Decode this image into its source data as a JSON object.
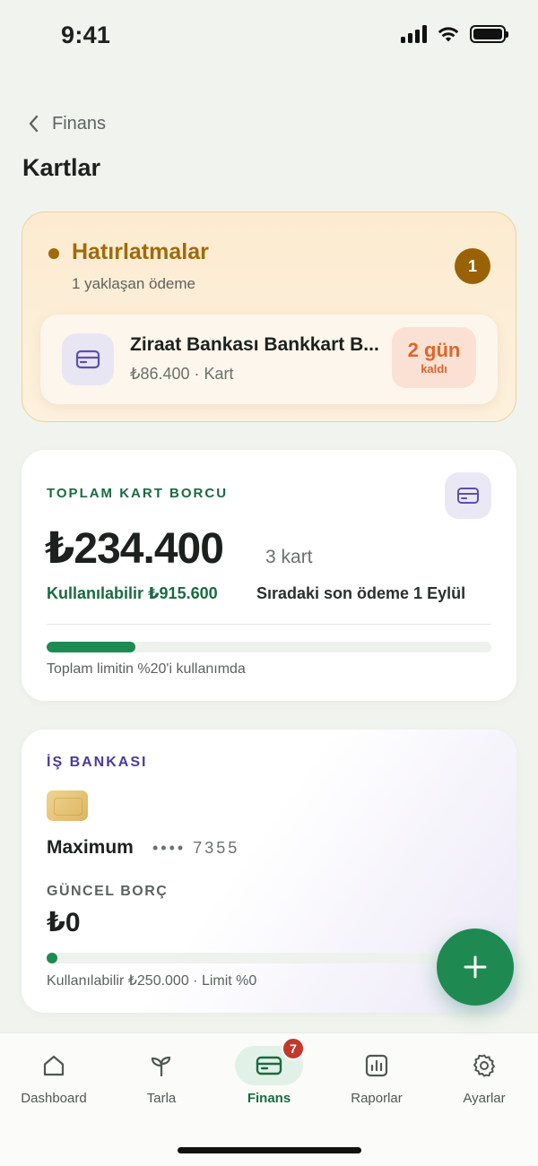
{
  "status_bar": {
    "time": "9:41"
  },
  "header": {
    "back_label": "Finans",
    "title": "Kartlar"
  },
  "reminders": {
    "title": "Hatırlatmalar",
    "subtitle": "1 yaklaşan ödeme",
    "count": "1",
    "items": [
      {
        "name": "Ziraat Bankası Bankkart B...",
        "meta": "₺86.400 · Kart",
        "due_days": "2 gün",
        "due_suffix": "kaldı"
      }
    ]
  },
  "total_debt": {
    "label": "TOPLAM KART BORCU",
    "amount": "₺234.400",
    "card_count": "3 kart",
    "available": "Kullanılabilir ₺915.600",
    "next_payment": "Sıradaki son ödeme 1 Eylül",
    "limit_usage_fraction": 0.2,
    "limit_text": "Toplam limitin %20'i kullanımda"
  },
  "cards": [
    {
      "bank": "İŞ BANKASI",
      "product": "Maximum",
      "number": "•••• 7355",
      "debt_label": "GÜNCEL BORÇ",
      "debt": "₺0",
      "meta": "Kullanılabilir ₺250.000 · Limit %0",
      "limit_usage_fraction": 0.0
    }
  ],
  "tab_bar": {
    "tabs": [
      {
        "label": "Dashboard",
        "icon": "home-icon"
      },
      {
        "label": "Tarla",
        "icon": "sprout-icon"
      },
      {
        "label": "Finans",
        "icon": "card-icon",
        "badge": "7",
        "active": true
      },
      {
        "label": "Raporlar",
        "icon": "chart-icon"
      },
      {
        "label": "Ayarlar",
        "icon": "gear-icon"
      }
    ]
  },
  "colors": {
    "accent": "#1e8a52",
    "reminder": "#a06a08",
    "due": "#e0642a",
    "bank_label": "#4b3a9e",
    "badge": "#c0392b"
  }
}
